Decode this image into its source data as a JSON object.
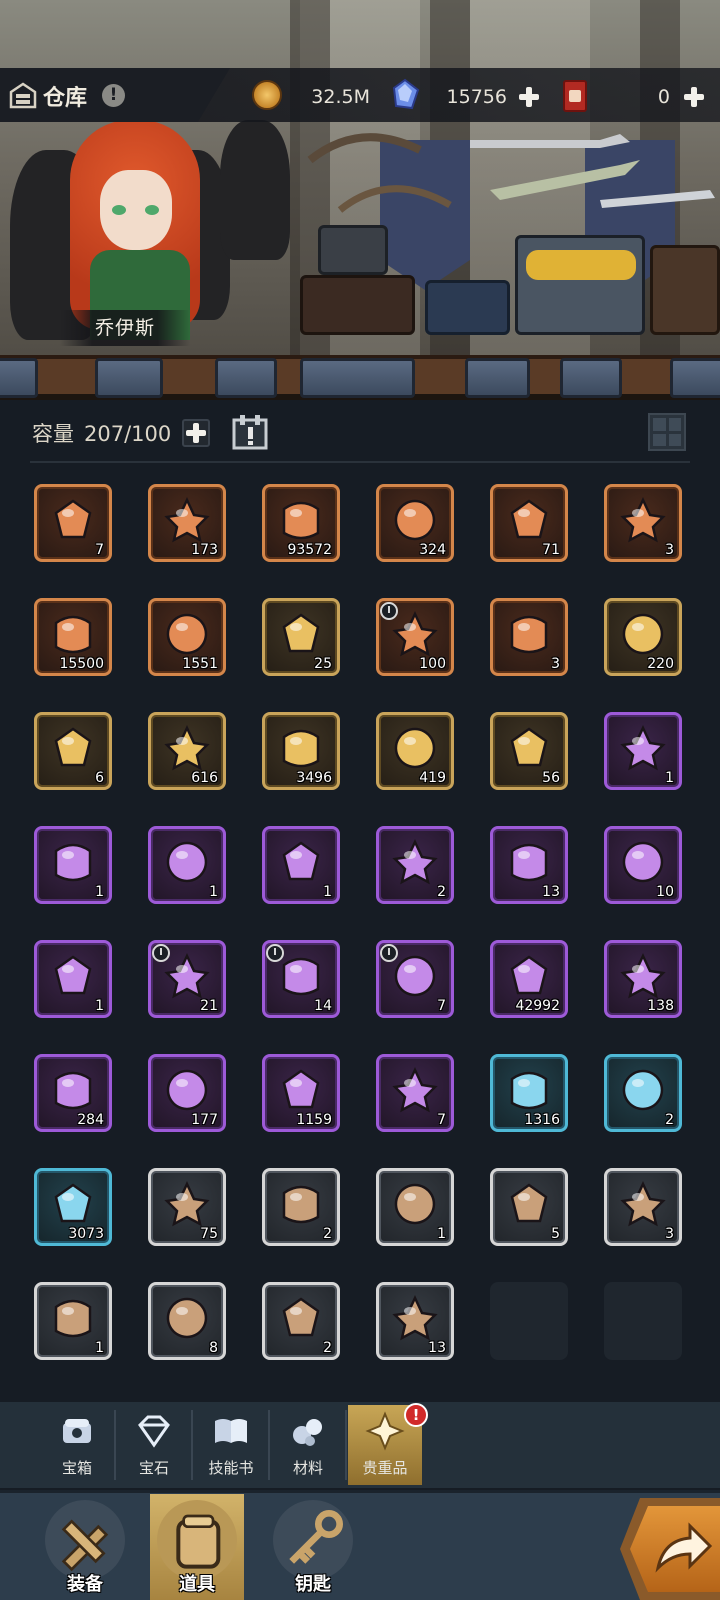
{
  "header": {
    "title": "仓库",
    "info_badge": "!",
    "coin_value": "32.5M",
    "gem_value": "15756",
    "ticket_value": "0"
  },
  "character": {
    "name": "乔伊斯"
  },
  "capacity": {
    "label": "容量",
    "value": "207/100"
  },
  "items": [
    {
      "rarity": "orange",
      "icon": "winged-halo-medal-icon",
      "count": "7"
    },
    {
      "rarity": "orange",
      "icon": "copper-crystal-icon",
      "count": "173"
    },
    {
      "rarity": "orange",
      "icon": "purple-crystal-icon",
      "count": "93572"
    },
    {
      "rarity": "orange",
      "icon": "pink-orb-icon",
      "count": "324"
    },
    {
      "rarity": "orange",
      "icon": "green-potion-sack-icon",
      "count": "71"
    },
    {
      "rarity": "orange",
      "icon": "ornate-emblem-icon",
      "count": "3"
    },
    {
      "rarity": "orange",
      "icon": "pink-gem-shard-icon",
      "count": "15500"
    },
    {
      "rarity": "orange",
      "icon": "paw-hexagon-icon",
      "count": "1551"
    },
    {
      "rarity": "gold",
      "icon": "green-scroll-icon",
      "count": "25"
    },
    {
      "rarity": "orange",
      "icon": "teal-orb-timed-icon",
      "count": "100",
      "timed": true
    },
    {
      "rarity": "orange",
      "icon": "gear-emblem-icon",
      "count": "3"
    },
    {
      "rarity": "gold",
      "icon": "golden-crest-icon",
      "count": "220"
    },
    {
      "rarity": "gold",
      "icon": "star-shard-icon",
      "count": "6"
    },
    {
      "rarity": "gold",
      "icon": "orange-crystal-icon",
      "count": "616"
    },
    {
      "rarity": "gold",
      "icon": "jeweled-orb-icon",
      "count": "3496"
    },
    {
      "rarity": "gold",
      "icon": "purple-flame-icon",
      "count": "419"
    },
    {
      "rarity": "gold",
      "icon": "fire-skull-icon",
      "count": "56"
    },
    {
      "rarity": "purple",
      "icon": "bread-icon",
      "count": "1"
    },
    {
      "rarity": "purple",
      "icon": "cheese-icon",
      "count": "1"
    },
    {
      "rarity": "purple",
      "icon": "cheese-wheel-icon",
      "count": "1"
    },
    {
      "rarity": "purple",
      "icon": "wine-bottle-icon",
      "count": "1"
    },
    {
      "rarity": "purple",
      "icon": "honey-jar-icon",
      "count": "2"
    },
    {
      "rarity": "purple",
      "icon": "toast-icon",
      "count": "13"
    },
    {
      "rarity": "purple",
      "icon": "cupcake-icon",
      "count": "10"
    },
    {
      "rarity": "purple",
      "icon": "cake-icon",
      "count": "1"
    },
    {
      "rarity": "purple",
      "icon": "flour-sack-icon",
      "count": "21",
      "timed": true
    },
    {
      "rarity": "purple",
      "icon": "honey-pot-icon",
      "count": "14",
      "timed": true
    },
    {
      "rarity": "purple",
      "icon": "berries-icon",
      "count": "7",
      "timed": true
    },
    {
      "rarity": "purple",
      "icon": "blue-map-icon",
      "count": "42992"
    },
    {
      "rarity": "purple",
      "icon": "golden-key-icon",
      "count": "138"
    },
    {
      "rarity": "purple",
      "icon": "green-pot-icon",
      "count": "284"
    },
    {
      "rarity": "purple",
      "icon": "stone-ring-icon",
      "count": "177"
    },
    {
      "rarity": "purple",
      "icon": "purple-claw-icon",
      "count": "1159"
    },
    {
      "rarity": "purple",
      "icon": "wooden-box-icon",
      "count": "7"
    },
    {
      "rarity": "blue",
      "icon": "ice-crystal-icon",
      "count": "1316"
    },
    {
      "rarity": "blue",
      "icon": "blue-cloth-icon",
      "count": "2"
    },
    {
      "rarity": "blue",
      "icon": "lava-rock-icon",
      "count": "3073"
    },
    {
      "rarity": "white",
      "icon": "red-potion-icon",
      "count": "75"
    },
    {
      "rarity": "white",
      "icon": "thread-spool-icon",
      "count": "2"
    },
    {
      "rarity": "white",
      "icon": "thread-spool-icon",
      "count": "1"
    },
    {
      "rarity": "white",
      "icon": "yarn-ball-icon",
      "count": "5"
    },
    {
      "rarity": "white",
      "icon": "fish-plush-icon",
      "count": "3"
    },
    {
      "rarity": "white",
      "icon": "torn-bag-icon",
      "count": "1"
    },
    {
      "rarity": "white",
      "icon": "herb-leaf-icon",
      "count": "8"
    },
    {
      "rarity": "white",
      "icon": "hooded-doll-icon",
      "count": "2"
    },
    {
      "rarity": "white",
      "icon": "cookie-icon",
      "count": "13"
    },
    {
      "rarity": "empty",
      "icon": "",
      "count": ""
    },
    {
      "rarity": "empty",
      "icon": "",
      "count": ""
    }
  ],
  "categories": [
    {
      "label": "宝箱",
      "icon": "chest-icon"
    },
    {
      "label": "宝石",
      "icon": "gem-icon"
    },
    {
      "label": "技能书",
      "icon": "book-icon"
    },
    {
      "label": "材料",
      "icon": "material-icon"
    },
    {
      "label": "贵重品",
      "icon": "valuable-icon",
      "active": true,
      "alert": "!"
    }
  ],
  "nav": [
    {
      "label": "装备",
      "icon": "equipment-icon"
    },
    {
      "label": "道具",
      "icon": "items-icon",
      "active": true
    },
    {
      "label": "钥匙",
      "icon": "key-icon"
    }
  ],
  "colors": {
    "orange": "#d4864a",
    "gold": "#c9a45a",
    "purple": "#9d5ad8",
    "blue": "#4fb9d6",
    "white": "#d6d6d6",
    "accent": "#c8a656"
  }
}
